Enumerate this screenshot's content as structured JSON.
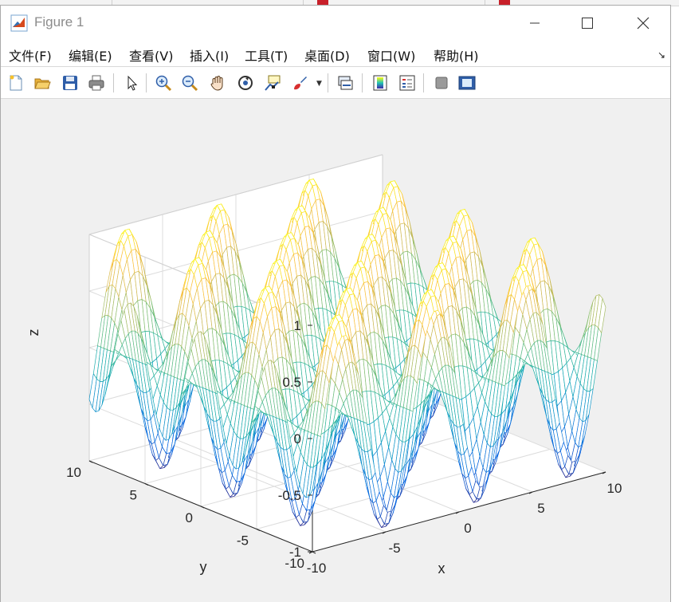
{
  "window": {
    "title": "Figure 1"
  },
  "menu": [
    {
      "id": "file",
      "label": "文件(F)"
    },
    {
      "id": "edit",
      "label": "编辑(E)"
    },
    {
      "id": "view",
      "label": "查看(V)"
    },
    {
      "id": "insert",
      "label": "插入(I)"
    },
    {
      "id": "tools",
      "label": "工具(T)"
    },
    {
      "id": "desktop",
      "label": "桌面(D)"
    },
    {
      "id": "window",
      "label": "窗口(W)"
    },
    {
      "id": "help",
      "label": "帮助(H)"
    }
  ],
  "toolbar": [
    "new-figure-icon",
    "open-file-icon",
    "save-icon",
    "print-icon",
    "select-pointer-icon",
    "zoom-in-icon",
    "zoom-out-icon",
    "pan-hand-icon",
    "rotate-3d-icon",
    "data-cursor-icon",
    "brush-icon",
    "link-plot-icon",
    "colorbar-icon",
    "legend-icon",
    "hide-plot-tools-icon",
    "show-plot-tools-icon"
  ],
  "colors": {
    "accent": "#0072bd",
    "surface_low": "#3e26a8",
    "surface_mid": "#21c4b6",
    "surface_high": "#f9fb15"
  },
  "chart_data": {
    "type": "mesh",
    "function": "z = sin(x) * cos(y)",
    "x_range": [
      -10,
      10
    ],
    "y_range": [
      -10,
      10
    ],
    "z_range": [
      -1,
      1
    ],
    "xlabel": "x",
    "ylabel": "y",
    "zlabel": "z",
    "xticks": [
      -10,
      -5,
      0,
      5,
      10
    ],
    "yticks": [
      -10,
      -5,
      0,
      5,
      10
    ],
    "zticks": [
      -1,
      -0.5,
      0,
      0.5,
      1
    ],
    "tick_labels": {
      "x": [
        "-10",
        "-5",
        "0",
        "5",
        "10"
      ],
      "y": [
        "-10",
        "-5",
        "0",
        "5",
        "10"
      ],
      "z": [
        "-1",
        "-0.5",
        "0",
        "0.5",
        "1"
      ]
    },
    "grid": true,
    "colormap": "parula"
  }
}
